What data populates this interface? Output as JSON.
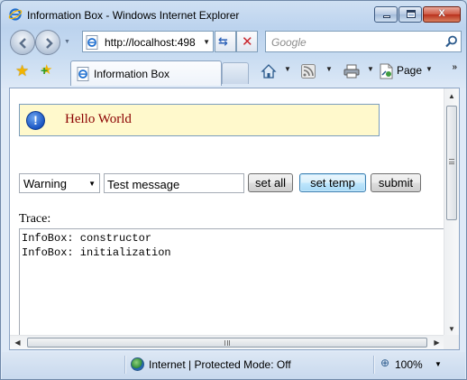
{
  "window": {
    "title": "Information Box - Windows Internet Explorer",
    "minimize_glyph": "",
    "close_glyph": "X"
  },
  "address_bar": {
    "url": "http://localhost:498",
    "search_placeholder": "Google"
  },
  "tabs": [
    {
      "label": "Information Box"
    }
  ],
  "command_bar": {
    "page_label": "Page",
    "more_glyph": "»"
  },
  "page": {
    "info_box": {
      "icon_glyph": "!",
      "message": "Hello World"
    },
    "type_select": {
      "value": "Warning"
    },
    "message_input": {
      "value": "Test message"
    },
    "buttons": {
      "set_all": "set all",
      "set_temp": "set temp",
      "submit": "submit"
    },
    "trace_label": "Trace:",
    "trace_lines": [
      "InfoBox: constructor",
      "InfoBox: initialization"
    ]
  },
  "status_bar": {
    "zone": "Internet | Protected Mode: Off",
    "zoom": "100%"
  },
  "icons": {
    "ie_logo": "ie-logo-icon",
    "search": "search-icon",
    "favorites": "star-icon",
    "add_favorites": "add-favorites-icon",
    "home": "home-icon",
    "feeds": "rss-feed-icon",
    "print": "printer-icon",
    "page": "page-icon",
    "globe": "globe-icon",
    "zoom": "zoom-icon",
    "info": "info-icon"
  },
  "colors": {
    "info_background": "#fff9cc",
    "info_text": "#8b0000",
    "info_icon": "#1a55c4"
  }
}
